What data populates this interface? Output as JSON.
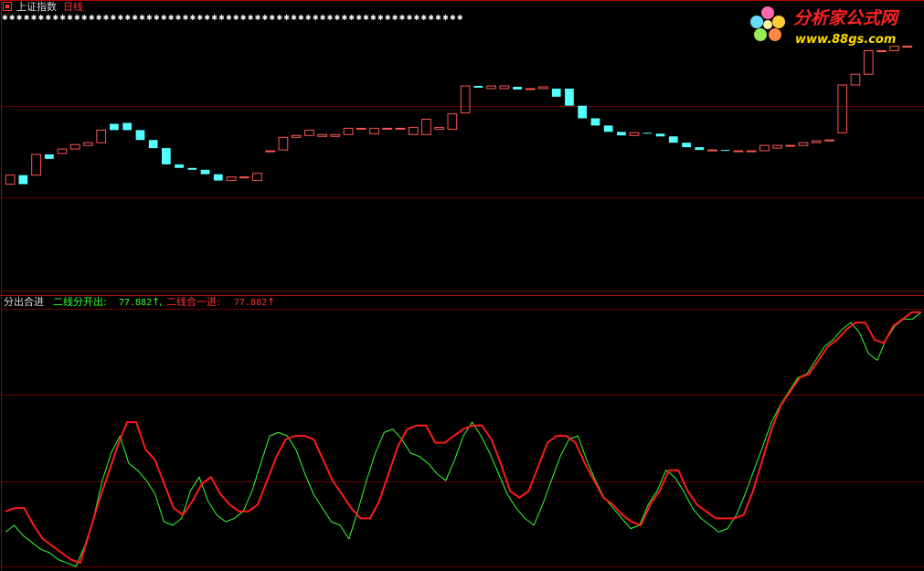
{
  "colors": {
    "background": "#000000",
    "frame": "#b00000",
    "grid": "#6a0000",
    "up_candle": "#ff5555",
    "down_candle": "#55ffff",
    "separator": "#aa1111",
    "line_open": "#33ff33",
    "line_close": "#ff1a1a",
    "stars": "#ffffff",
    "header_white": "#d9d9d9",
    "header_red": "#ff3333",
    "header_green": "#33ff33",
    "logo_red": "#ff2222",
    "logo_yellow": "#ffdd00"
  },
  "top_panel": {
    "icon": "square-icon",
    "title": "上证指数",
    "period": "日线",
    "star_row": "✱✱✱✱✱✱✱✱✱✱✱✱✱✱✱✱✱✱✱✱✱✱✱✱✱✱✱✱✱✱✱✱✱✱✱✱✱✱✱✱✱✱✱✱✱✱✱✱✱✱✱✱✱✱✱✱✱✱✱✱✱✱✱✱"
  },
  "logo": {
    "name": "分析家公式网",
    "url": "www.88gs.com",
    "icon": "flower-icon"
  },
  "bottom_panel": {
    "title": "分出合进",
    "label_open": "二线分开出:",
    "value_open": "77.882",
    "arrow_open": "↑",
    "sep": ",",
    "label_close": "二线合一进:",
    "value_close": "77.882",
    "arrow_close": "↑"
  },
  "chart_data": [
    {
      "type": "candlestick",
      "title": "上证指数 日线",
      "candles": [
        {
          "o": 118,
          "c": 128,
          "h": 128,
          "l": 118
        },
        {
          "o": 128,
          "c": 118,
          "h": 128,
          "l": 118
        },
        {
          "o": 128,
          "c": 151,
          "h": 151,
          "l": 128
        },
        {
          "o": 151,
          "c": 146,
          "h": 151,
          "l": 146
        },
        {
          "o": 152,
          "c": 157,
          "h": 157,
          "l": 152
        },
        {
          "o": 157,
          "c": 162,
          "h": 162,
          "l": 157
        },
        {
          "o": 161,
          "c": 164,
          "h": 164,
          "l": 161
        },
        {
          "o": 164,
          "c": 178,
          "h": 178,
          "l": 164
        },
        {
          "o": 185,
          "c": 178,
          "h": 185,
          "l": 178
        },
        {
          "o": 186,
          "c": 178,
          "h": 186,
          "l": 178
        },
        {
          "o": 178,
          "c": 167,
          "h": 178,
          "l": 167
        },
        {
          "o": 167,
          "c": 158,
          "h": 167,
          "l": 158
        },
        {
          "o": 158,
          "c": 140,
          "h": 158,
          "l": 140
        },
        {
          "o": 140,
          "c": 136,
          "h": 140,
          "l": 136
        },
        {
          "o": 136,
          "c": 134,
          "h": 136,
          "l": 134
        },
        {
          "o": 134,
          "c": 129,
          "h": 134,
          "l": 129
        },
        {
          "o": 129,
          "c": 122,
          "h": 129,
          "l": 122
        },
        {
          "o": 122,
          "c": 126,
          "h": 126,
          "l": 122
        },
        {
          "o": 126,
          "c": 126,
          "h": 126,
          "l": 126
        },
        {
          "o": 122,
          "c": 130,
          "h": 130,
          "l": 122
        },
        {
          "o": 154,
          "c": 155,
          "h": 155,
          "l": 154
        },
        {
          "o": 156,
          "c": 170,
          "h": 170,
          "l": 156
        },
        {
          "o": 170,
          "c": 172,
          "h": 172,
          "l": 170
        },
        {
          "o": 172,
          "c": 178,
          "h": 178,
          "l": 172
        },
        {
          "o": 171,
          "c": 173,
          "h": 173,
          "l": 171
        },
        {
          "o": 171,
          "c": 173,
          "h": 173,
          "l": 171
        },
        {
          "o": 173,
          "c": 180,
          "h": 180,
          "l": 173
        },
        {
          "o": 180,
          "c": 180,
          "h": 180,
          "l": 180
        },
        {
          "o": 174,
          "c": 180,
          "h": 180,
          "l": 174
        },
        {
          "o": 180,
          "c": 180,
          "h": 180,
          "l": 180
        },
        {
          "o": 180,
          "c": 180,
          "h": 180,
          "l": 180
        },
        {
          "o": 173,
          "c": 181,
          "h": 181,
          "l": 173
        },
        {
          "o": 173,
          "c": 190,
          "h": 190,
          "l": 173
        },
        {
          "o": 179,
          "c": 181,
          "h": 181,
          "l": 179
        },
        {
          "o": 179,
          "c": 196,
          "h": 196,
          "l": 179
        },
        {
          "o": 197,
          "c": 227,
          "h": 227,
          "l": 197
        },
        {
          "o": 227,
          "c": 225,
          "h": 227,
          "l": 225
        },
        {
          "o": 224,
          "c": 227,
          "h": 227,
          "l": 224
        },
        {
          "o": 224,
          "c": 227,
          "h": 227,
          "l": 224
        },
        {
          "o": 226,
          "c": 223,
          "h": 227,
          "l": 223
        },
        {
          "o": 223,
          "c": 224,
          "h": 224,
          "l": 223
        },
        {
          "o": 224,
          "c": 226,
          "h": 226,
          "l": 224
        },
        {
          "o": 224,
          "c": 215,
          "h": 224,
          "l": 215
        },
        {
          "o": 224,
          "c": 205,
          "h": 224,
          "l": 205
        },
        {
          "o": 205,
          "c": 191,
          "h": 205,
          "l": 191
        },
        {
          "o": 191,
          "c": 183,
          "h": 191,
          "l": 183
        },
        {
          "o": 183,
          "c": 176,
          "h": 183,
          "l": 176
        },
        {
          "o": 176,
          "c": 172,
          "h": 176,
          "l": 172
        },
        {
          "o": 172,
          "c": 175,
          "h": 175,
          "l": 172
        },
        {
          "o": 175,
          "c": 174,
          "h": 175,
          "l": 174
        },
        {
          "o": 174,
          "c": 171,
          "h": 174,
          "l": 171
        },
        {
          "o": 171,
          "c": 164,
          "h": 171,
          "l": 164
        },
        {
          "o": 164,
          "c": 159,
          "h": 164,
          "l": 159
        },
        {
          "o": 159,
          "c": 156,
          "h": 159,
          "l": 156
        },
        {
          "o": 156,
          "c": 156,
          "h": 156,
          "l": 156
        },
        {
          "o": 156,
          "c": 155,
          "h": 155,
          "l": 155
        },
        {
          "o": 155,
          "c": 155,
          "h": 155,
          "l": 155
        },
        {
          "o": 155,
          "c": 155,
          "h": 155,
          "l": 155
        },
        {
          "o": 155,
          "c": 161,
          "h": 161,
          "l": 155
        },
        {
          "o": 158,
          "c": 161,
          "h": 161,
          "l": 158
        },
        {
          "o": 161,
          "c": 161,
          "h": 161,
          "l": 161
        },
        {
          "o": 161,
          "c": 164,
          "h": 164,
          "l": 161
        },
        {
          "o": 164,
          "c": 166,
          "h": 166,
          "l": 164
        },
        {
          "o": 166,
          "c": 167,
          "h": 167,
          "l": 166
        },
        {
          "o": 175,
          "c": 228,
          "h": 228,
          "l": 175
        },
        {
          "o": 228,
          "c": 240,
          "h": 240,
          "l": 228
        },
        {
          "o": 240,
          "c": 266,
          "h": 266,
          "l": 240
        },
        {
          "o": 266,
          "c": 266,
          "h": 266,
          "l": 266
        },
        {
          "o": 266,
          "c": 271,
          "h": 271,
          "l": 266
        },
        {
          "o": 271,
          "c": 271,
          "h": 271,
          "l": 271
        }
      ],
      "xlabel": "",
      "ylabel": ""
    },
    {
      "type": "line",
      "title": "分出合进",
      "series": [
        {
          "name": "二线分开出",
          "values": [
            10,
            12,
            9,
            7,
            5,
            4,
            2,
            1,
            0,
            6,
            14,
            25,
            33,
            38,
            30,
            28,
            25,
            21,
            13,
            12,
            14,
            22,
            26,
            19,
            15,
            13,
            14,
            16,
            22,
            30,
            38,
            39,
            38,
            34,
            27,
            21,
            17,
            13,
            12,
            8,
            16,
            25,
            33,
            39,
            40,
            37,
            33,
            32,
            30,
            27,
            25,
            31,
            38,
            42,
            38,
            33,
            27,
            21,
            17,
            14,
            12,
            18,
            25,
            32,
            37,
            38,
            31,
            25,
            20,
            17,
            14,
            11,
            12,
            18,
            22,
            28,
            26,
            22,
            17,
            14,
            12,
            10,
            11,
            15,
            21,
            28,
            35,
            42,
            47,
            51,
            55,
            56,
            60,
            64,
            66,
            69,
            71,
            68,
            62,
            60,
            66,
            70,
            72,
            72,
            74
          ]
        },
        {
          "name": "二线合一进",
          "values": [
            16,
            17,
            17,
            12,
            8,
            6,
            4,
            2,
            1,
            10,
            19,
            27,
            35,
            42,
            42,
            34,
            31,
            24,
            17,
            15,
            19,
            24,
            26,
            21,
            18,
            16,
            16,
            18,
            25,
            32,
            37,
            38,
            38,
            37,
            31,
            25,
            21,
            17,
            14,
            14,
            19,
            27,
            35,
            40,
            41,
            41,
            36,
            36,
            38,
            40,
            41,
            41,
            37,
            30,
            22,
            20,
            22,
            29,
            36,
            38,
            38,
            36,
            30,
            25,
            20,
            18,
            15,
            13,
            12,
            18,
            22,
            28,
            28,
            22,
            18,
            16,
            14,
            14,
            14,
            15,
            22,
            31,
            40,
            47,
            51,
            55,
            56,
            60,
            64,
            66,
            69,
            71,
            71,
            66,
            65,
            70,
            72,
            74,
            74
          ]
        }
      ],
      "xlabel": "",
      "ylabel": ""
    }
  ]
}
